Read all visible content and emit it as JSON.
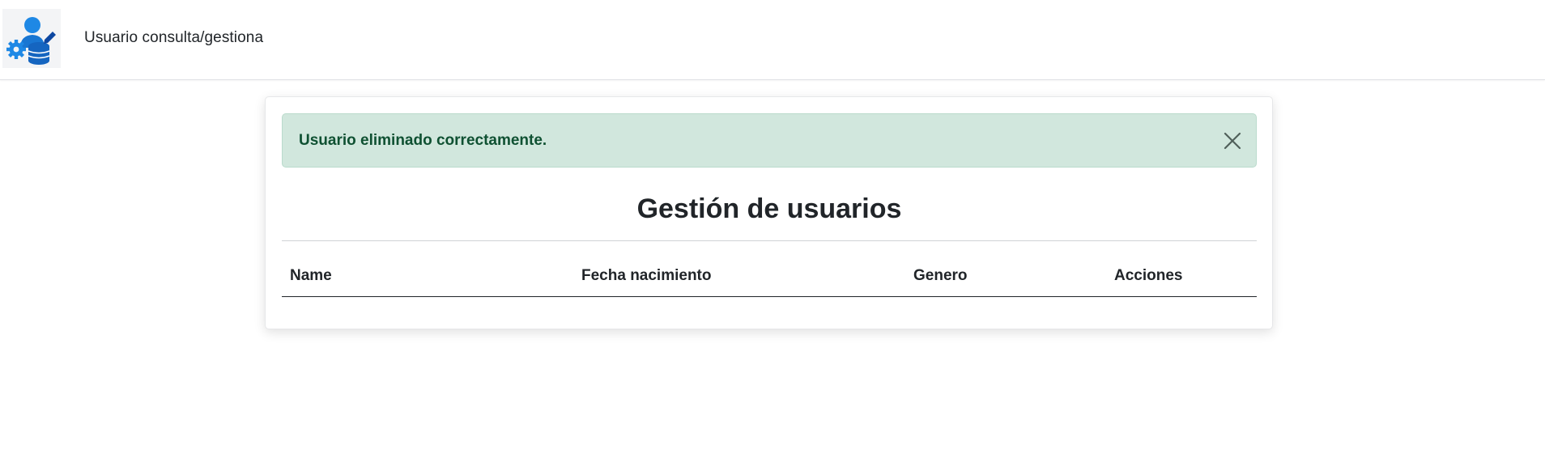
{
  "navbar": {
    "title": "Usuario consulta/gestiona",
    "logo_icon": "user-settings-database-icon",
    "logo_colors": {
      "primary": "#1e88e5",
      "accent": "#1565c0"
    }
  },
  "alert": {
    "message": "Usuario eliminado correctamente.",
    "close_icon": "close-icon",
    "colors": {
      "background": "#d1e7dd",
      "text": "#0f5132"
    }
  },
  "page": {
    "heading": "Gestión de usuarios"
  },
  "table": {
    "columns": [
      "Name",
      "Fecha nacimiento",
      "Genero",
      "Acciones"
    ],
    "rows": []
  }
}
